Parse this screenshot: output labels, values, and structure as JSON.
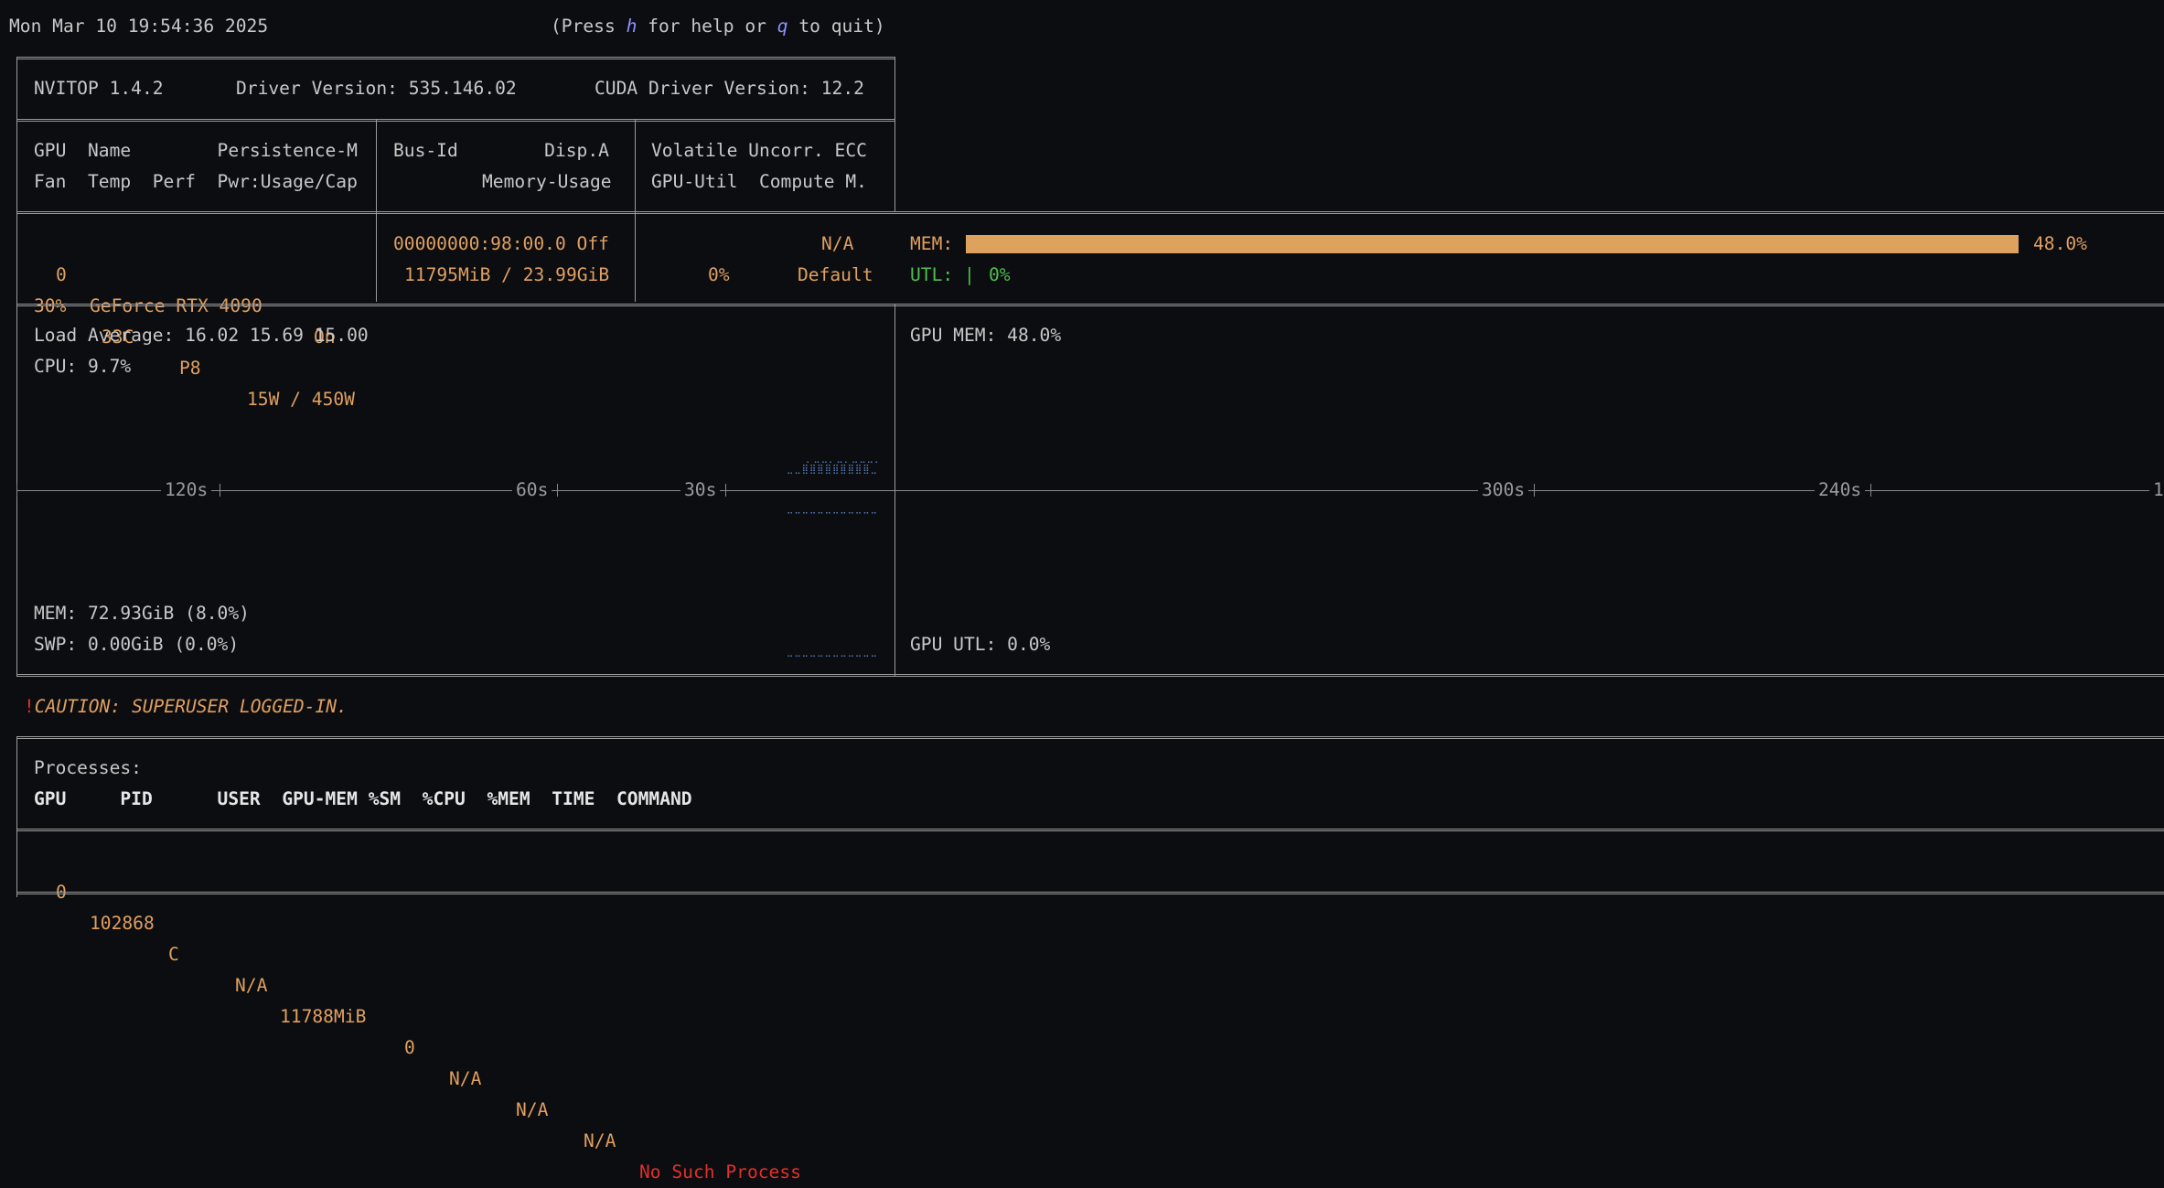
{
  "header": {
    "datetime": "Mon Mar 10 19:54:36 2025",
    "help_prefix": "(Press ",
    "help_key": "h",
    "help_mid": " for help or ",
    "quit_key": "q",
    "help_suffix": " to quit)"
  },
  "versions": {
    "nvitop": "NVITOP 1.4.2",
    "driver": "Driver Version: 535.146.02",
    "cuda": "CUDA Driver Version: 12.2"
  },
  "gpu_table_headers": {
    "row1_col1": "GPU  Name        Persistence-M",
    "row1_col2": "Bus-Id        Disp.A",
    "row1_col3": "Volatile Uncorr. ECC",
    "row2_col1": "Fan  Temp  Perf  Pwr:Usage/Cap",
    "row2_col2": "Memory-Usage",
    "row2_col3": "GPU-Util  Compute M."
  },
  "gpu": {
    "index": "0",
    "name": "GeForce RTX 4090",
    "persistence": "On",
    "bus_id": "00000000:98:00.0",
    "disp": "Off",
    "ecc": "N/A",
    "fan": "30%",
    "temp": "33C",
    "perf": "P8",
    "power": "15W / 450W",
    "memory_usage": "11795MiB / 23.99GiB",
    "util": "0%",
    "compute_mode": "Default",
    "mem_label": "MEM:",
    "mem_percent": "48.0%",
    "mem_fraction": 0.48,
    "utl_label": "UTL:",
    "utl_bar": "|",
    "utl_percent": "0%",
    "utl_fraction": 0.0
  },
  "host": {
    "load_average": "Load Average: 16.02 15.69 15.00",
    "cpu": "CPU: 9.7%",
    "mem": "MEM: 72.93GiB (8.0%)",
    "swp": "SWP: 0.00GiB (0.0%)",
    "gpu_mem": "GPU MEM: 48.0%",
    "gpu_utl": "GPU UTL: 0.0%",
    "axis_left": [
      "120s",
      "60s",
      "30s"
    ],
    "axis_right": [
      "300s",
      "240s",
      "1"
    ]
  },
  "caution": {
    "mark": "!",
    "text": "CAUTION: SUPERUSER LOGGED-IN."
  },
  "processes": {
    "title": "Processes:",
    "headers": "GPU     PID      USER  GPU-MEM %SM  %CPU  %MEM  TIME  COMMAND",
    "rows": [
      {
        "gpu": "0",
        "pid": "102868",
        "type": "C",
        "user": "N/A",
        "gpu_mem": "11788MiB",
        "sm": "0",
        "cpu": "N/A",
        "mem": "N/A",
        "time": "N/A",
        "command": "No Such Process"
      }
    ]
  },
  "colors": {
    "background": "#0c0d10",
    "accent_orange": "#e0a060",
    "bar_orange": "#dca25e",
    "green": "#4fbf4f",
    "red": "#e0302a",
    "key_blue": "#8f8fff"
  }
}
